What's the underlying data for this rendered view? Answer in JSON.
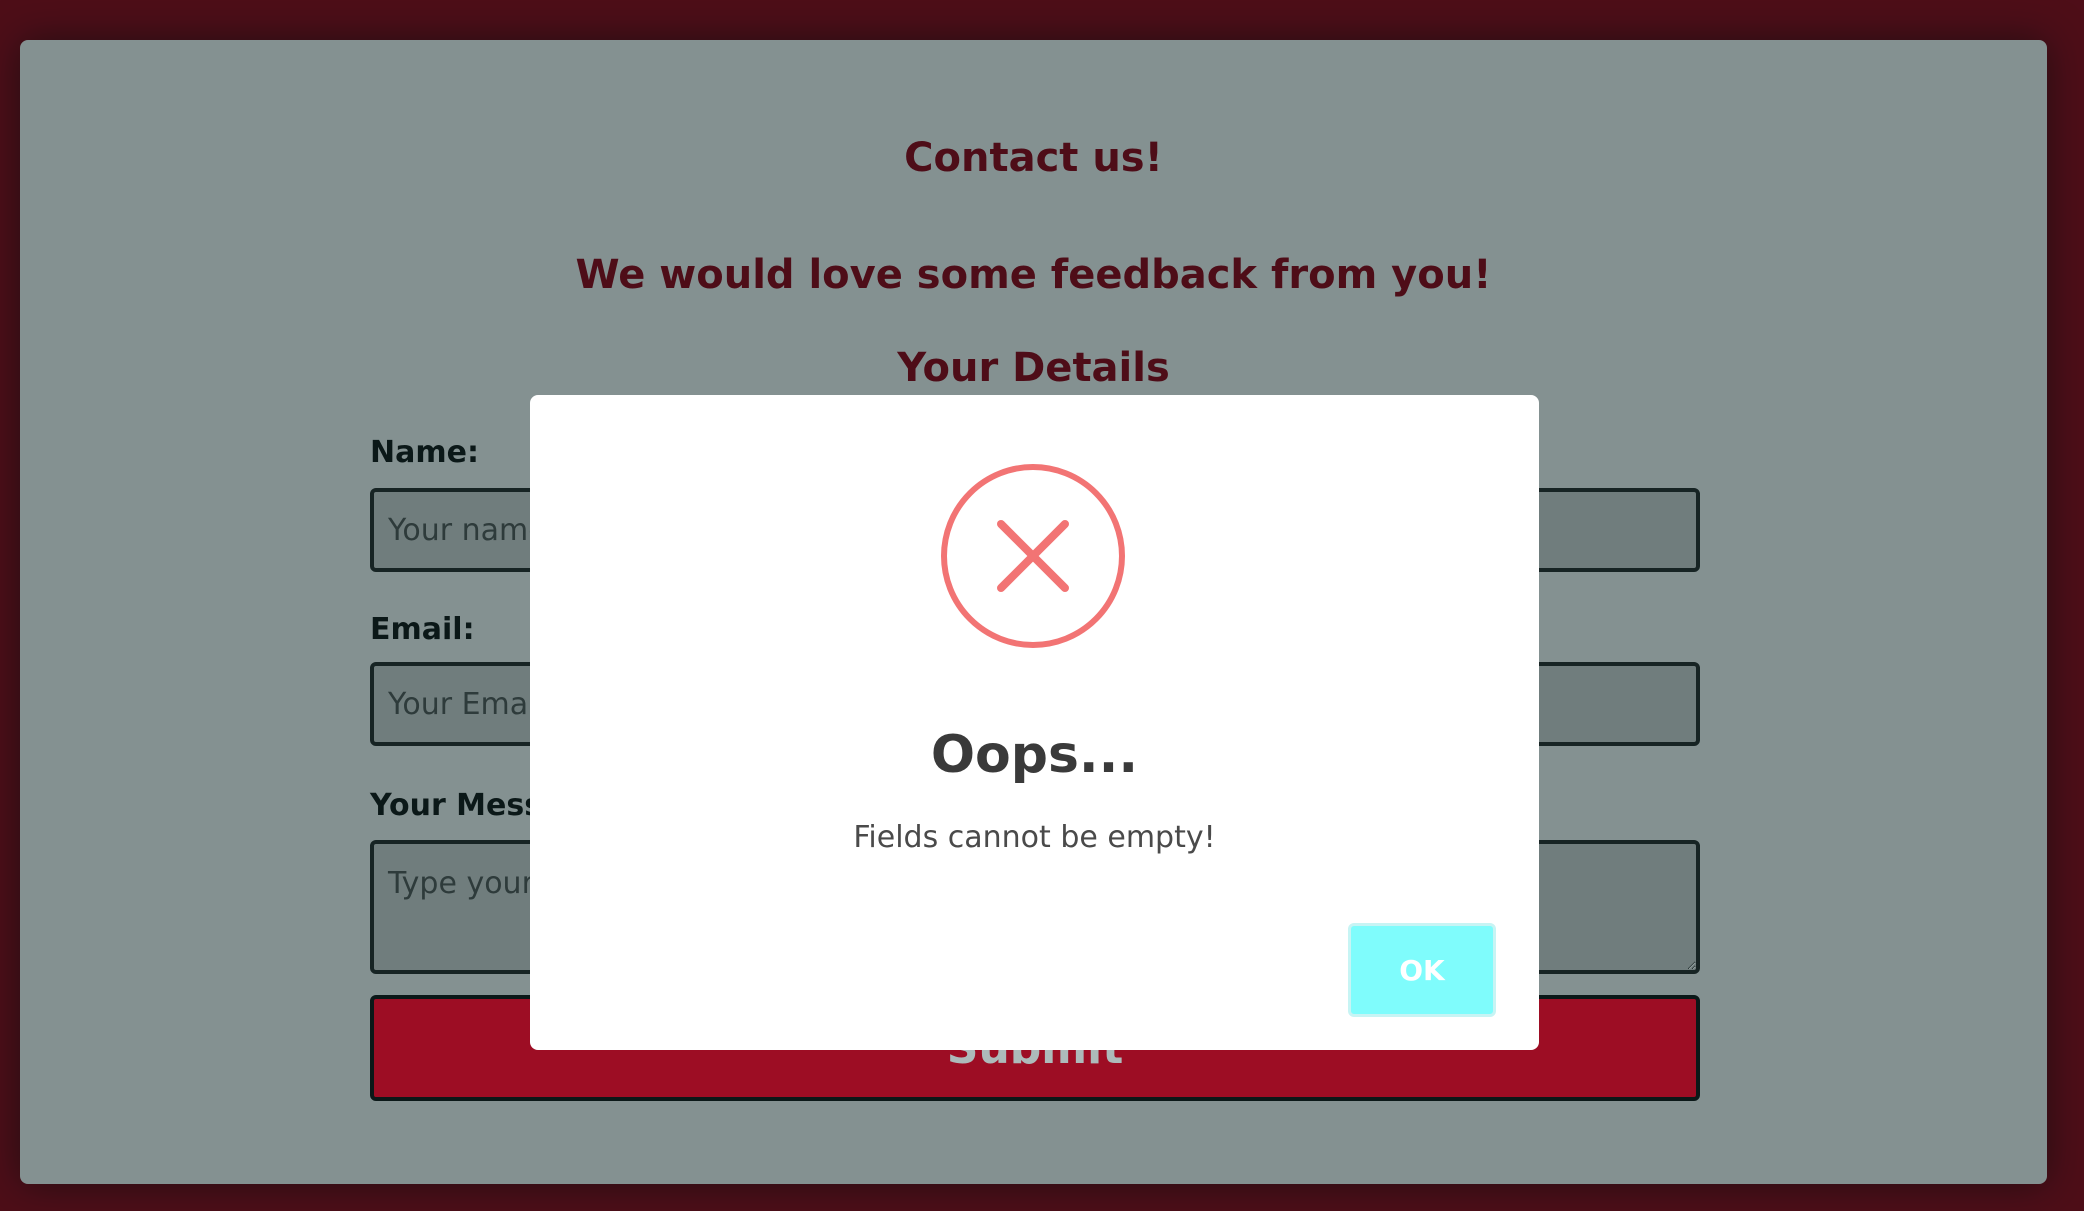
{
  "form": {
    "title": "Contact us!",
    "subtitle": "We would love some feedback from you!",
    "section_title": "Your Details",
    "name_label": "Name:",
    "name_placeholder": "Your name",
    "email_label": "Email:",
    "email_placeholder": "Your Email",
    "message_label": "Your Message:",
    "message_placeholder": "Type your message",
    "submit_label": "Submit"
  },
  "dialog": {
    "icon": "error-x-icon",
    "title": "Oops...",
    "message": "Fields cannot be empty!",
    "ok_label": "OK"
  },
  "colors": {
    "page_border": "#730011",
    "panel_background": "#c3c3c3",
    "heading_text": "#730011",
    "submit_button": "#e70022",
    "error_icon": "#f27474",
    "ok_button": "#7ffcfc"
  }
}
